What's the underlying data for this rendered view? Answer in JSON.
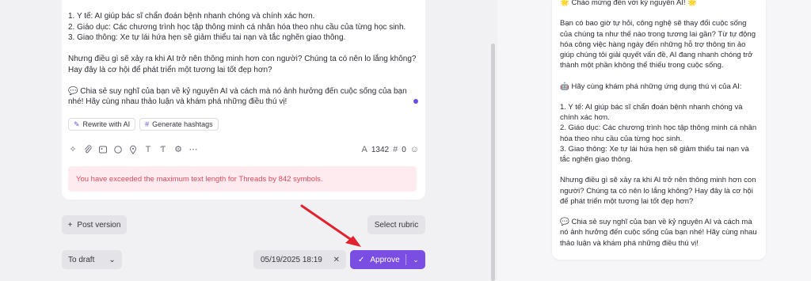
{
  "editor": {
    "lines": [
      "1. Y tế: AI giúp bác sĩ chẩn đoán bệnh nhanh chóng và chính xác hơn.",
      "2. Giáo dục: Các chương trình học tập thông minh cá nhân hóa theo nhu cầu của từng học sinh.",
      "3. Giao thông: Xe tự lái hứa hẹn sẽ giảm thiểu tai nạn và tắc nghẽn giao thông."
    ],
    "para2": "Nhưng điều gì sẽ xảy ra khi AI trở nên thông minh hơn con người? Chúng ta có nên lo lắng không? Hay đây là cơ hội để phát triển một tương lai tốt đẹp hơn?",
    "para3": "💬 Chia sẻ suy nghĩ của bạn về kỷ nguyên AI và cách mà nó ảnh hưởng đến cuộc sống của bạn nhé! Hãy cùng nhau thảo luận và khám phá những điều thú vị!",
    "chips": {
      "rewrite": "Rewrite with AI",
      "hashtags": "Generate hashtags"
    },
    "char_count": "1342",
    "hashtag_count": "0",
    "error": "You have exceeded the maximum text length for Threads by 842 symbols."
  },
  "actions": {
    "post_version": "Post version",
    "select_rubric": "Select rubric",
    "to_draft": "To draft",
    "date": "05/19/2025 18:19",
    "approve": "Approve"
  },
  "preview": {
    "line1": "🌟 Chào mừng đến với kỷ nguyên AI! 🌟",
    "para1": "Bạn có bao giờ tự hỏi, công nghệ sẽ thay đổi cuộc sống của chúng ta như thế nào trong tương lai gần? Từ tự động hóa công việc hàng ngày đến những hỗ trợ thông tin ảo giúp chúng tôi giải quyết vấn đề, AI đang nhanh chóng trở thành một phần không thể thiếu trong cuộc sống.",
    "para2": "🤖 Hãy cùng khám phá những ứng dụng thú vị của AI:",
    "list1": "1. Y tế: AI giúp bác sĩ chẩn đoán bệnh nhanh chóng và chính xác hơn.",
    "list2": "2. Giáo dục: Các chương trình học tập thông minh cá nhân hóa theo nhu cầu của từng học sinh.",
    "list3": "3. Giao thông: Xe tự lái hứa hẹn sẽ giảm thiểu tai nạn và tắc nghẽn giao thông.",
    "para3": "Nhưng điều gì sẽ xảy ra khi AI trở nên thông minh hơn con người? Chúng ta có nên lo lắng không? Hay đây là cơ hội để phát triển một tương lai tốt đẹp hơn?",
    "para4": "💬 Chia sẻ suy nghĩ của bạn về kỷ nguyên AI và cách mà nó ảnh hưởng đến cuộc sống của bạn nhé! Hãy cùng nhau thảo luận và khám phá những điều thú vị!"
  },
  "colors": {
    "accent": "#7a4ee3",
    "error_text": "#dc4a5c",
    "error_bg": "#fdebef",
    "annotation_arrow": "#e0232e"
  },
  "icons": [
    "sparkle-icon",
    "paperclip-icon",
    "image-icon",
    "comment-icon",
    "location-icon",
    "text-icon",
    "font-icon",
    "settings-icon",
    "more-icon",
    "char-count-icon",
    "hashtag-icon",
    "emoji-icon",
    "pencil-icon",
    "plus-icon",
    "chevron-down-icon",
    "close-icon",
    "check-icon"
  ]
}
